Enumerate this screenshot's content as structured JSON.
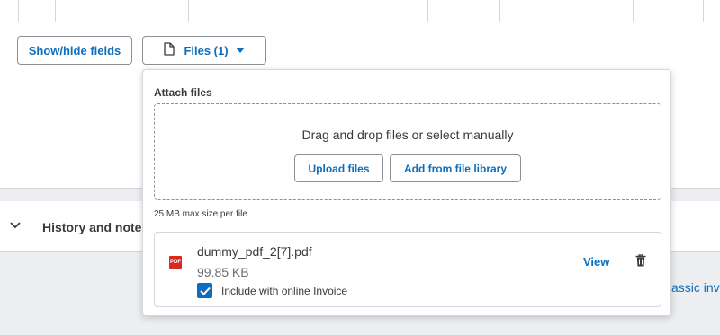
{
  "toolbar": {
    "show_hide_label": "Show/hide fields",
    "files_label": "Files (1)"
  },
  "attach": {
    "title": "Attach files",
    "drop_hint": "Drag and drop files or select manually",
    "upload_label": "Upload files",
    "library_label": "Add from file library",
    "max_size": "25 MB max size per file"
  },
  "file": {
    "name": "dummy_pdf_2[7].pdf",
    "size": "99.85 KB",
    "include_label": "Include with online Invoice",
    "include_checked": true,
    "view_label": "View",
    "icon_text": "PDF"
  },
  "background": {
    "history_label": "History and note",
    "classic_link": "assic inv"
  },
  "colors": {
    "accent": "#0d6ebd",
    "pdf_red": "#d52b1e",
    "border": "#d4d7dc",
    "band": "#eceef1"
  },
  "icons": {
    "files_button": "file-icon",
    "caret": "caret-down-icon",
    "trash": "trash-icon",
    "checkbox": "checkmark-icon",
    "history_toggle": "chevron-down-icon"
  }
}
